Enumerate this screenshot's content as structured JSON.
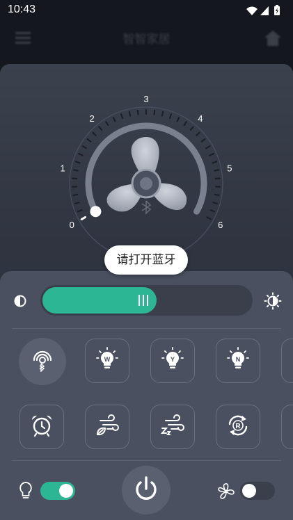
{
  "status_bar": {
    "time": "10:43"
  },
  "app_bar": {
    "title": "智智家居",
    "menu_icon": "menu-icon",
    "home_icon": "home-icon"
  },
  "dial": {
    "min": 0,
    "max": 6,
    "ticks": [
      "0",
      "1",
      "2",
      "3",
      "4",
      "5",
      "6"
    ],
    "current_speed": 0,
    "fan_icon": "fan-icon",
    "bluetooth_icon": "bluetooth-small-icon"
  },
  "toast": {
    "text": "请打开蓝牙"
  },
  "brightness": {
    "level": 0.55,
    "low_icon": "brightness-low-icon",
    "high_icon": "brightness-high-icon",
    "handle_label": "III"
  },
  "modes_row1": [
    {
      "name": "bluetooth-button",
      "icon": "bluetooth-icon"
    },
    {
      "name": "warm-light-button",
      "icon": "bulb-w-icon",
      "letter": "W"
    },
    {
      "name": "yellow-light-button",
      "icon": "bulb-y-icon",
      "letter": "Y"
    },
    {
      "name": "neutral-light-button",
      "icon": "bulb-n-icon",
      "letter": "N"
    }
  ],
  "modes_row2": [
    {
      "name": "timer-button",
      "icon": "alarm-clock-icon"
    },
    {
      "name": "natural-wind-button",
      "icon": "wind-leaf-icon"
    },
    {
      "name": "sleep-wind-button",
      "icon": "wind-sleep-icon"
    },
    {
      "name": "reverse-button",
      "icon": "reverse-r-icon",
      "letter": "R"
    }
  ],
  "bottom": {
    "light_toggle_on": true,
    "fan_toggle_on": false,
    "accent": "#2cb694"
  }
}
